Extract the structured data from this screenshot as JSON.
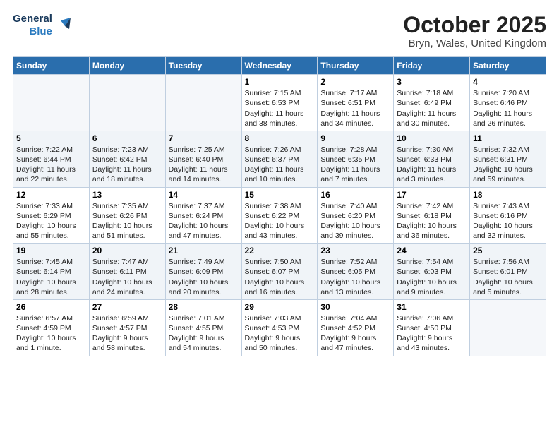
{
  "header": {
    "logo_line1": "General",
    "logo_line2": "Blue",
    "month_title": "October 2025",
    "location": "Bryn, Wales, United Kingdom"
  },
  "weekdays": [
    "Sunday",
    "Monday",
    "Tuesday",
    "Wednesday",
    "Thursday",
    "Friday",
    "Saturday"
  ],
  "weeks": [
    [
      {
        "num": "",
        "info": ""
      },
      {
        "num": "",
        "info": ""
      },
      {
        "num": "",
        "info": ""
      },
      {
        "num": "1",
        "info": "Sunrise: 7:15 AM\nSunset: 6:53 PM\nDaylight: 11 hours\nand 38 minutes."
      },
      {
        "num": "2",
        "info": "Sunrise: 7:17 AM\nSunset: 6:51 PM\nDaylight: 11 hours\nand 34 minutes."
      },
      {
        "num": "3",
        "info": "Sunrise: 7:18 AM\nSunset: 6:49 PM\nDaylight: 11 hours\nand 30 minutes."
      },
      {
        "num": "4",
        "info": "Sunrise: 7:20 AM\nSunset: 6:46 PM\nDaylight: 11 hours\nand 26 minutes."
      }
    ],
    [
      {
        "num": "5",
        "info": "Sunrise: 7:22 AM\nSunset: 6:44 PM\nDaylight: 11 hours\nand 22 minutes."
      },
      {
        "num": "6",
        "info": "Sunrise: 7:23 AM\nSunset: 6:42 PM\nDaylight: 11 hours\nand 18 minutes."
      },
      {
        "num": "7",
        "info": "Sunrise: 7:25 AM\nSunset: 6:40 PM\nDaylight: 11 hours\nand 14 minutes."
      },
      {
        "num": "8",
        "info": "Sunrise: 7:26 AM\nSunset: 6:37 PM\nDaylight: 11 hours\nand 10 minutes."
      },
      {
        "num": "9",
        "info": "Sunrise: 7:28 AM\nSunset: 6:35 PM\nDaylight: 11 hours\nand 7 minutes."
      },
      {
        "num": "10",
        "info": "Sunrise: 7:30 AM\nSunset: 6:33 PM\nDaylight: 11 hours\nand 3 minutes."
      },
      {
        "num": "11",
        "info": "Sunrise: 7:32 AM\nSunset: 6:31 PM\nDaylight: 10 hours\nand 59 minutes."
      }
    ],
    [
      {
        "num": "12",
        "info": "Sunrise: 7:33 AM\nSunset: 6:29 PM\nDaylight: 10 hours\nand 55 minutes."
      },
      {
        "num": "13",
        "info": "Sunrise: 7:35 AM\nSunset: 6:26 PM\nDaylight: 10 hours\nand 51 minutes."
      },
      {
        "num": "14",
        "info": "Sunrise: 7:37 AM\nSunset: 6:24 PM\nDaylight: 10 hours\nand 47 minutes."
      },
      {
        "num": "15",
        "info": "Sunrise: 7:38 AM\nSunset: 6:22 PM\nDaylight: 10 hours\nand 43 minutes."
      },
      {
        "num": "16",
        "info": "Sunrise: 7:40 AM\nSunset: 6:20 PM\nDaylight: 10 hours\nand 39 minutes."
      },
      {
        "num": "17",
        "info": "Sunrise: 7:42 AM\nSunset: 6:18 PM\nDaylight: 10 hours\nand 36 minutes."
      },
      {
        "num": "18",
        "info": "Sunrise: 7:43 AM\nSunset: 6:16 PM\nDaylight: 10 hours\nand 32 minutes."
      }
    ],
    [
      {
        "num": "19",
        "info": "Sunrise: 7:45 AM\nSunset: 6:14 PM\nDaylight: 10 hours\nand 28 minutes."
      },
      {
        "num": "20",
        "info": "Sunrise: 7:47 AM\nSunset: 6:11 PM\nDaylight: 10 hours\nand 24 minutes."
      },
      {
        "num": "21",
        "info": "Sunrise: 7:49 AM\nSunset: 6:09 PM\nDaylight: 10 hours\nand 20 minutes."
      },
      {
        "num": "22",
        "info": "Sunrise: 7:50 AM\nSunset: 6:07 PM\nDaylight: 10 hours\nand 16 minutes."
      },
      {
        "num": "23",
        "info": "Sunrise: 7:52 AM\nSunset: 6:05 PM\nDaylight: 10 hours\nand 13 minutes."
      },
      {
        "num": "24",
        "info": "Sunrise: 7:54 AM\nSunset: 6:03 PM\nDaylight: 10 hours\nand 9 minutes."
      },
      {
        "num": "25",
        "info": "Sunrise: 7:56 AM\nSunset: 6:01 PM\nDaylight: 10 hours\nand 5 minutes."
      }
    ],
    [
      {
        "num": "26",
        "info": "Sunrise: 6:57 AM\nSunset: 4:59 PM\nDaylight: 10 hours\nand 1 minute."
      },
      {
        "num": "27",
        "info": "Sunrise: 6:59 AM\nSunset: 4:57 PM\nDaylight: 9 hours\nand 58 minutes."
      },
      {
        "num": "28",
        "info": "Sunrise: 7:01 AM\nSunset: 4:55 PM\nDaylight: 9 hours\nand 54 minutes."
      },
      {
        "num": "29",
        "info": "Sunrise: 7:03 AM\nSunset: 4:53 PM\nDaylight: 9 hours\nand 50 minutes."
      },
      {
        "num": "30",
        "info": "Sunrise: 7:04 AM\nSunset: 4:52 PM\nDaylight: 9 hours\nand 47 minutes."
      },
      {
        "num": "31",
        "info": "Sunrise: 7:06 AM\nSunset: 4:50 PM\nDaylight: 9 hours\nand 43 minutes."
      },
      {
        "num": "",
        "info": ""
      }
    ]
  ]
}
